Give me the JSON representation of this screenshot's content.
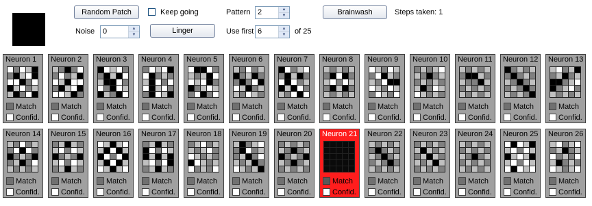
{
  "controls": {
    "random_patch_label": "Random Patch",
    "keep_going_label": "Keep going",
    "keep_going_checked": false,
    "pattern_label": "Pattern",
    "pattern_value": "2",
    "brainwash_label": "Brainwash",
    "steps_label": "Steps taken: 1",
    "noise_label": "Noise",
    "noise_value": "0",
    "linger_label": "Linger",
    "use_first_label": "Use first",
    "use_first_value": "6",
    "of_total_label": "of 25"
  },
  "neuron_match_label": "Match",
  "neuron_confid_label": "Confid.",
  "neurons": [
    {
      "label": "Neuron 1",
      "cells": [
        "#ffffff",
        "#808080",
        "#ffffff",
        "#c0c0c0",
        "#000000",
        "#808080",
        "#000000",
        "#c0c0c0",
        "#ffffff",
        "#000000",
        "#ffffff",
        "#ffffff",
        "#000000",
        "#808080",
        "#ffffff",
        "#000000",
        "#c0c0c0",
        "#ffffff",
        "#808080",
        "#c0c0c0",
        "#c0c0c0",
        "#000000",
        "#808080",
        "#ffffff",
        "#000000"
      ]
    },
    {
      "label": "Neuron 2",
      "cells": [
        "#c0c0c0",
        "#808080",
        "#000000",
        "#808080",
        "#ffffff",
        "#808080",
        "#ffffff",
        "#808080",
        "#c0c0c0",
        "#000000",
        "#ffffff",
        "#c0c0c0",
        "#000000",
        "#ffffff",
        "#ffffff",
        "#808080",
        "#000000",
        "#c0c0c0",
        "#ffffff",
        "#000000",
        "#ffffff",
        "#ffffff",
        "#c0c0c0",
        "#000000",
        "#808080"
      ]
    },
    {
      "label": "Neuron 3",
      "cells": [
        "#000000",
        "#ffffff",
        "#c0c0c0",
        "#ffffff",
        "#808080",
        "#808080",
        "#000000",
        "#c0c0c0",
        "#000000",
        "#ffffff",
        "#c0c0c0",
        "#000000",
        "#000000",
        "#ffffff",
        "#808080",
        "#ffffff",
        "#808080",
        "#000000",
        "#ffffff",
        "#c0c0c0",
        "#000000",
        "#c0c0c0",
        "#808080",
        "#000000",
        "#ffffff"
      ]
    },
    {
      "label": "Neuron 4",
      "cells": [
        "#808080",
        "#ffffff",
        "#c0c0c0",
        "#ffffff",
        "#000000",
        "#ffffff",
        "#000000",
        "#808080",
        "#c0c0c0",
        "#808080",
        "#c0c0c0",
        "#000000",
        "#ffffff",
        "#808080",
        "#ffffff",
        "#ffffff",
        "#000000",
        "#c0c0c0",
        "#ffffff",
        "#808080",
        "#808080",
        "#000000",
        "#ffffff",
        "#c0c0c0",
        "#000000"
      ]
    },
    {
      "label": "Neuron 5",
      "cells": [
        "#ffffff",
        "#000000",
        "#000000",
        "#ffffff",
        "#808080",
        "#c0c0c0",
        "#808080",
        "#c0c0c0",
        "#000000",
        "#ffffff",
        "#ffffff",
        "#c0c0c0",
        "#ffffff",
        "#000000",
        "#808080",
        "#000000",
        "#808080",
        "#c0c0c0",
        "#ffffff",
        "#c0c0c0",
        "#808080",
        "#ffffff",
        "#000000",
        "#808080",
        "#ffffff"
      ]
    },
    {
      "label": "Neuron 6",
      "cells": [
        "#c0c0c0",
        "#808080",
        "#ffffff",
        "#808080",
        "#c0c0c0",
        "#000000",
        "#808080",
        "#c0c0c0",
        "#000000",
        "#808080",
        "#808080",
        "#000000",
        "#808080",
        "#ffffff",
        "#000000",
        "#ffffff",
        "#c0c0c0",
        "#000000",
        "#808080",
        "#c0c0c0",
        "#c0c0c0",
        "#808080",
        "#ffffff",
        "#c0c0c0",
        "#808080"
      ]
    },
    {
      "label": "Neuron 7",
      "cells": [
        "#000000",
        "#ffffff",
        "#808080",
        "#c0c0c0",
        "#ffffff",
        "#808080",
        "#000000",
        "#c0c0c0",
        "#000000",
        "#808080",
        "#ffffff",
        "#000000",
        "#ffffff",
        "#808080",
        "#c0c0c0",
        "#000000",
        "#c0c0c0",
        "#000000",
        "#ffffff",
        "#808080",
        "#c0c0c0",
        "#808080",
        "#ffffff",
        "#000000",
        "#ffffff"
      ]
    },
    {
      "label": "Neuron 8",
      "cells": [
        "#c0c0c0",
        "#808080",
        "#c0c0c0",
        "#808080",
        "#c0c0c0",
        "#808080",
        "#000000",
        "#ffffff",
        "#000000",
        "#808080",
        "#c0c0c0",
        "#ffffff",
        "#808080",
        "#ffffff",
        "#c0c0c0",
        "#808080",
        "#000000",
        "#c0c0c0",
        "#000000",
        "#808080",
        "#c0c0c0",
        "#808080",
        "#c0c0c0",
        "#808080",
        "#c0c0c0"
      ]
    },
    {
      "label": "Neuron 9",
      "cells": [
        "#ffffff",
        "#c0c0c0",
        "#808080",
        "#ffffff",
        "#c0c0c0",
        "#808080",
        "#ffffff",
        "#000000",
        "#c0c0c0",
        "#808080",
        "#c0c0c0",
        "#808080",
        "#ffffff",
        "#000000",
        "#000000",
        "#ffffff",
        "#c0c0c0",
        "#808080",
        "#ffffff",
        "#c0c0c0",
        "#808080",
        "#ffffff",
        "#c0c0c0",
        "#808080",
        "#ffffff"
      ]
    },
    {
      "label": "Neuron 10",
      "cells": [
        "#808080",
        "#c0c0c0",
        "#808080",
        "#c0c0c0",
        "#ffffff",
        "#c0c0c0",
        "#808080",
        "#000000",
        "#808080",
        "#c0c0c0",
        "#808080",
        "#c0c0c0",
        "#808080",
        "#c0c0c0",
        "#808080",
        "#c0c0c0",
        "#000000",
        "#808080",
        "#ffffff",
        "#c0c0c0",
        "#ffffff",
        "#c0c0c0",
        "#808080",
        "#c0c0c0",
        "#808080"
      ]
    },
    {
      "label": "Neuron 11",
      "cells": [
        "#c0c0c0",
        "#808080",
        "#c0c0c0",
        "#808080",
        "#c0c0c0",
        "#808080",
        "#000000",
        "#000000",
        "#c0c0c0",
        "#808080",
        "#c0c0c0",
        "#808080",
        "#808080",
        "#000000",
        "#c0c0c0",
        "#808080",
        "#c0c0c0",
        "#808080",
        "#c0c0c0",
        "#808080",
        "#c0c0c0",
        "#808080",
        "#c0c0c0",
        "#808080",
        "#c0c0c0"
      ]
    },
    {
      "label": "Neuron 12",
      "cells": [
        "#000000",
        "#808080",
        "#c0c0c0",
        "#808080",
        "#c0c0c0",
        "#808080",
        "#000000",
        "#808080",
        "#c0c0c0",
        "#808080",
        "#c0c0c0",
        "#808080",
        "#000000",
        "#808080",
        "#c0c0c0",
        "#808080",
        "#c0c0c0",
        "#808080",
        "#000000",
        "#808080",
        "#c0c0c0",
        "#808080",
        "#c0c0c0",
        "#808080",
        "#000000"
      ]
    },
    {
      "label": "Neuron 13",
      "cells": [
        "#c0c0c0",
        "#ffffff",
        "#808080",
        "#c0c0c0",
        "#000000",
        "#808080",
        "#c0c0c0",
        "#000000",
        "#808080",
        "#c0c0c0",
        "#000000",
        "#000000",
        "#808080",
        "#c0c0c0",
        "#ffffff",
        "#000000",
        "#808080",
        "#c0c0c0",
        "#ffffff",
        "#808080",
        "#c0c0c0",
        "#808080",
        "#c0c0c0",
        "#808080",
        "#c0c0c0"
      ]
    },
    {
      "label": "Neuron 14",
      "cells": [
        "#c0c0c0",
        "#808080",
        "#ffffff",
        "#808080",
        "#c0c0c0",
        "#808080",
        "#ffffff",
        "#000000",
        "#ffffff",
        "#808080",
        "#000000",
        "#808080",
        "#c0c0c0",
        "#808080",
        "#000000",
        "#808080",
        "#c0c0c0",
        "#000000",
        "#808080",
        "#ffffff",
        "#c0c0c0",
        "#808080",
        "#c0c0c0",
        "#808080",
        "#c0c0c0"
      ]
    },
    {
      "label": "Neuron 15",
      "cells": [
        "#808080",
        "#c0c0c0",
        "#000000",
        "#c0c0c0",
        "#808080",
        "#c0c0c0",
        "#ffffff",
        "#808080",
        "#ffffff",
        "#c0c0c0",
        "#000000",
        "#808080",
        "#c0c0c0",
        "#808080",
        "#000000",
        "#c0c0c0",
        "#ffffff",
        "#808080",
        "#ffffff",
        "#c0c0c0",
        "#808080",
        "#c0c0c0",
        "#000000",
        "#c0c0c0",
        "#808080"
      ]
    },
    {
      "label": "Neuron 16",
      "cells": [
        "#ffffff",
        "#c0c0c0",
        "#000000",
        "#c0c0c0",
        "#ffffff",
        "#c0c0c0",
        "#000000",
        "#ffffff",
        "#000000",
        "#c0c0c0",
        "#000000",
        "#ffffff",
        "#808080",
        "#ffffff",
        "#000000",
        "#c0c0c0",
        "#000000",
        "#ffffff",
        "#000000",
        "#c0c0c0",
        "#ffffff",
        "#c0c0c0",
        "#000000",
        "#c0c0c0",
        "#ffffff"
      ]
    },
    {
      "label": "Neuron 17",
      "cells": [
        "#808080",
        "#c0c0c0",
        "#000000",
        "#c0c0c0",
        "#808080",
        "#000000",
        "#ffffff",
        "#808080",
        "#ffffff",
        "#c0c0c0",
        "#000000",
        "#c0c0c0",
        "#000000",
        "#c0c0c0",
        "#000000",
        "#c0c0c0",
        "#ffffff",
        "#808080",
        "#ffffff",
        "#000000",
        "#808080",
        "#c0c0c0",
        "#000000",
        "#c0c0c0",
        "#808080"
      ]
    },
    {
      "label": "Neuron 18",
      "cells": [
        "#808080",
        "#c0c0c0",
        "#ffffff",
        "#808080",
        "#c0c0c0",
        "#c0c0c0",
        "#808080",
        "#c0c0c0",
        "#ffffff",
        "#808080",
        "#ffffff",
        "#c0c0c0",
        "#808080",
        "#c0c0c0",
        "#808080",
        "#000000",
        "#ffffff",
        "#c0c0c0",
        "#808080",
        "#c0c0c0",
        "#ffffff",
        "#808080",
        "#c0c0c0",
        "#808080",
        "#ffffff"
      ]
    },
    {
      "label": "Neuron 19",
      "cells": [
        "#c0c0c0",
        "#000000",
        "#808080",
        "#c0c0c0",
        "#ffffff",
        "#808080",
        "#000000",
        "#ffffff",
        "#808080",
        "#c0c0c0",
        "#808080",
        "#c0c0c0",
        "#000000",
        "#808080",
        "#ffffff",
        "#c0c0c0",
        "#808080",
        "#c0c0c0",
        "#000000",
        "#808080",
        "#ffffff",
        "#c0c0c0",
        "#808080",
        "#c0c0c0",
        "#000000"
      ]
    },
    {
      "label": "Neuron 20",
      "cells": [
        "#808080",
        "#c0c0c0",
        "#808080",
        "#c0c0c0",
        "#808080",
        "#c0c0c0",
        "#808080",
        "#000000",
        "#808080",
        "#c0c0c0",
        "#000000",
        "#808080",
        "#c0c0c0",
        "#808080",
        "#000000",
        "#c0c0c0",
        "#808080",
        "#000000",
        "#808080",
        "#c0c0c0",
        "#808080",
        "#c0c0c0",
        "#808080",
        "#c0c0c0",
        "#808080"
      ]
    },
    {
      "label": "Neuron 21",
      "cells": [
        "#0a0a0a",
        "#0a0a0a",
        "#0a0a0a",
        "#0a0a0a",
        "#0a0a0a",
        "#0a0a0a",
        "#0a0a0a",
        "#0a0a0a",
        "#0a0a0a",
        "#0a0a0a",
        "#0a0a0a",
        "#0a0a0a",
        "#0a0a0a",
        "#0a0a0a",
        "#0a0a0a",
        "#0a0a0a",
        "#0a0a0a",
        "#0a0a0a",
        "#0a0a0a",
        "#0a0a0a",
        "#0a0a0a",
        "#0a0a0a",
        "#0a0a0a",
        "#0a0a0a",
        "#0a0a0a"
      ],
      "active": true
    },
    {
      "label": "Neuron 22",
      "cells": [
        "#c0c0c0",
        "#808080",
        "#c0c0c0",
        "#808080",
        "#c0c0c0",
        "#808080",
        "#000000",
        "#808080",
        "#c0c0c0",
        "#808080",
        "#c0c0c0",
        "#808080",
        "#000000",
        "#808080",
        "#c0c0c0",
        "#808080",
        "#c0c0c0",
        "#808080",
        "#000000",
        "#808080",
        "#c0c0c0",
        "#808080",
        "#c0c0c0",
        "#808080",
        "#c0c0c0"
      ]
    },
    {
      "label": "Neuron 23",
      "cells": [
        "#808080",
        "#c0c0c0",
        "#808080",
        "#c0c0c0",
        "#808080",
        "#c0c0c0",
        "#000000",
        "#c0c0c0",
        "#808080",
        "#c0c0c0",
        "#808080",
        "#c0c0c0",
        "#000000",
        "#c0c0c0",
        "#808080",
        "#c0c0c0",
        "#808080",
        "#c0c0c0",
        "#000000",
        "#c0c0c0",
        "#808080",
        "#c0c0c0",
        "#808080",
        "#c0c0c0",
        "#808080"
      ]
    },
    {
      "label": "Neuron 24",
      "cells": [
        "#c0c0c0",
        "#808080",
        "#c0c0c0",
        "#808080",
        "#c0c0c0",
        "#808080",
        "#c0c0c0",
        "#808080",
        "#c0c0c0",
        "#808080",
        "#c0c0c0",
        "#808080",
        "#000000",
        "#808080",
        "#c0c0c0",
        "#808080",
        "#c0c0c0",
        "#808080",
        "#c0c0c0",
        "#808080",
        "#c0c0c0",
        "#808080",
        "#c0c0c0",
        "#808080",
        "#c0c0c0"
      ]
    },
    {
      "label": "Neuron 25",
      "cells": [
        "#ffffff",
        "#000000",
        "#ffffff",
        "#c0c0c0",
        "#000000",
        "#c0c0c0",
        "#ffffff",
        "#808080",
        "#ffffff",
        "#c0c0c0",
        "#000000",
        "#c0c0c0",
        "#ffffff",
        "#c0c0c0",
        "#000000",
        "#c0c0c0",
        "#ffffff",
        "#808080",
        "#ffffff",
        "#c0c0c0",
        "#ffffff",
        "#000000",
        "#ffffff",
        "#c0c0c0",
        "#ffffff"
      ]
    },
    {
      "label": "Neuron 26",
      "cells": [
        "#c0c0c0",
        "#ffffff",
        "#808080",
        "#c0c0c0",
        "#ffffff",
        "#808080",
        "#c0c0c0",
        "#000000",
        "#808080",
        "#c0c0c0",
        "#ffffff",
        "#808080",
        "#c0c0c0",
        "#808080",
        "#ffffff",
        "#c0c0c0",
        "#000000",
        "#808080",
        "#c0c0c0",
        "#808080",
        "#ffffff",
        "#c0c0c0",
        "#808080",
        "#c0c0c0",
        "#ffffff"
      ]
    }
  ]
}
